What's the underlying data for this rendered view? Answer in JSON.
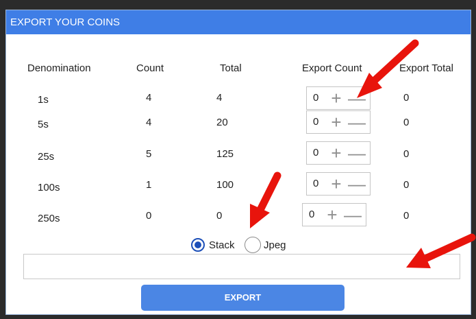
{
  "window": {
    "title": "EXPORT YOUR COINS"
  },
  "table": {
    "headers": [
      "Denomination",
      "Count",
      "Total",
      "Export Count",
      "Export Total"
    ],
    "rows": [
      {
        "denomination": "1s",
        "count": "4",
        "total": "4",
        "export_count": "0",
        "export_total": "0"
      },
      {
        "denomination": "5s",
        "count": "4",
        "total": "20",
        "export_count": "0",
        "export_total": "0"
      },
      {
        "denomination": "25s",
        "count": "5",
        "total": "125",
        "export_count": "0",
        "export_total": "0"
      },
      {
        "denomination": "100s",
        "count": "1",
        "total": "100",
        "export_count": "0",
        "export_total": "0"
      },
      {
        "denomination": "250s",
        "count": "0",
        "total": "0",
        "export_count": "0",
        "export_total": "0"
      }
    ],
    "stepper": {
      "plus_glyph": "+",
      "minus_glyph": "—"
    }
  },
  "format": {
    "options": [
      "Stack",
      "Jpeg"
    ],
    "selected": "Stack"
  },
  "path_field": {
    "value": "",
    "placeholder": ""
  },
  "export_button": {
    "label": "EXPORT"
  },
  "annotations": {
    "arrow_color": "#e8140c",
    "count": 3
  },
  "colors": {
    "titlebar": "#3f7ee6",
    "button": "#4b86e4",
    "radio_selected": "#1c4fb8"
  }
}
